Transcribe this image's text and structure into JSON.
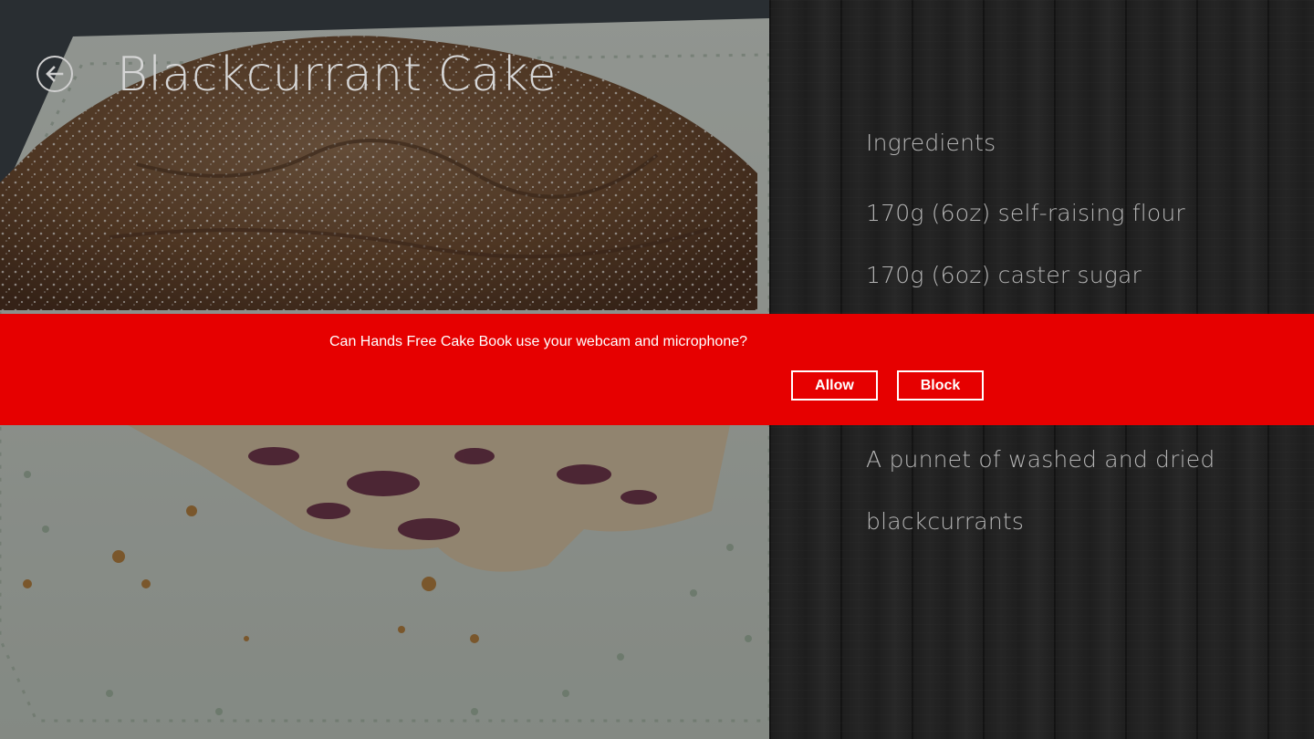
{
  "header": {
    "title": "Blackcurrant Cake"
  },
  "icons": {
    "back": "back-arrow-icon"
  },
  "ingredients": {
    "heading": "Ingredients",
    "items": [
      "170g (6oz) self-raising flour",
      "170g (6oz) caster sugar",
      "A punnet of washed and dried",
      "blackcurrants"
    ]
  },
  "permission_banner": {
    "message": "Can Hands Free Cake Book use your webcam and microphone?",
    "allow_label": "Allow",
    "block_label": "Block",
    "background_color": "#e60000"
  }
}
